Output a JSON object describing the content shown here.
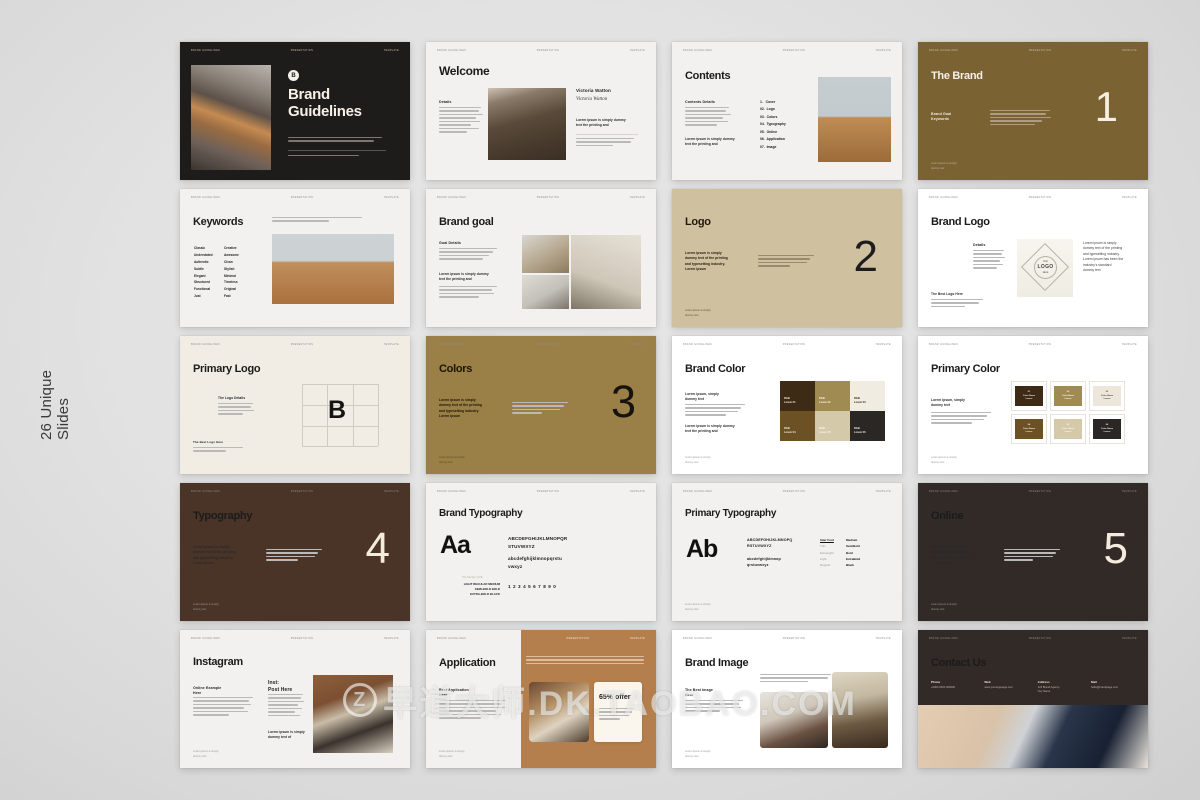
{
  "page": {
    "side_label": "26 Unique\nSlides",
    "background_color": "#e2e2e2"
  },
  "watermark": {
    "mark_letter": "Z",
    "text": "早道大师.DK.TAOBAO.COM"
  },
  "slide_chrome": {
    "header_left": "BRAND  GUIDELINES",
    "header_center": "PRESENTATION",
    "header_right": "TEMPLATE",
    "footer": "Lorem ipsum is simply\ndummy text"
  },
  "palette": {
    "dark": "#1d1c1b",
    "dark_warm": "#312a26",
    "brown": "#7a6233",
    "brown_light": "#9a7f46",
    "brown_deep": "#4a3327",
    "tan": "#cfc0a0",
    "cream": "#f1ede4",
    "offwhite": "#f2f1ef",
    "swatch_1": "#3d2b16",
    "swatch_2": "#a08b52",
    "swatch_3": "#f0ece1",
    "swatch_4": "#6b5124",
    "swatch_5": "#d4c9a8",
    "swatch_6": "#2b2724"
  },
  "slides": [
    {
      "id": "cover",
      "title": "Brand\nGuidelines",
      "logo_mark": "B",
      "body": "Lorem ipsum is simply dummy text of the printing and\ntypesetting industry. Lorem ipsum has been the industry's standard dummy t...",
      "footer": "Lorem ipsum simply dummy text of the printing"
    },
    {
      "id": "welcome",
      "title": "Welcome",
      "label": "Details",
      "person_name": "Victoria Watton",
      "signature": "Victoria Watton",
      "quote": "Lorem ipsum is simply dummy\ntext  the printing and"
    },
    {
      "id": "contents",
      "title": "Contents",
      "label": "Contents Details",
      "items": [
        "1.   Cover",
        "02.  Logo",
        "03.  Colors",
        "04.  Typography",
        "05.  Online",
        "06.  Application",
        "07.  Image"
      ],
      "note": "Lorem ipsum is simply dummy\ntext  the printing and"
    },
    {
      "id": "the-brand",
      "title": "The Brand",
      "label": "Brand Goal\nKeywords",
      "number": "1"
    },
    {
      "id": "keywords",
      "title": "Keywords",
      "intro": "Lorem ipsum is simply dummy text of the printing and typesetting industry. Lorem\nipsum has been the industry's standard dummy",
      "keywords_left": [
        "Classic",
        "Understated",
        "Authentic",
        "Subtle",
        "Elegant",
        "Structured",
        "Functional",
        "Just"
      ],
      "keywords_right": [
        "Creative",
        "Awesome",
        "Clean",
        "Stylish",
        "Minimal",
        "Timeless",
        "Original",
        "Fast"
      ]
    },
    {
      "id": "brand-goal",
      "title": "Brand goal",
      "label": "Goal Details",
      "subhead": "Lorem ipsum is simply dummy\ntext  the printing and"
    },
    {
      "id": "logo",
      "title": "Logo",
      "body": "Lorem ipsum is simply\ndummy text of the printing\nand typesetting industry.\nLorem ipsum",
      "number": "2"
    },
    {
      "id": "brand-logo",
      "title": "Brand   Logo",
      "label": "Details",
      "logo_top": "Your",
      "logo_main": "LOGO",
      "logo_bottom": "Here",
      "body": "Lorem ipsum is simply\ndummy text of the printing\nand typesetting industry.\nLorem ipsum has been the\nindustry's standard\ndummy text",
      "bullets_label": "The Best  Logo Here"
    },
    {
      "id": "primary-logo",
      "title": "Primary Logo",
      "label": "The Logo Details",
      "mark": "B",
      "bullets_label": "The Best Logo Here"
    },
    {
      "id": "colors",
      "title": "Colors",
      "body": "Lorem ipsum is simply\ndummy text of the printing\nand typesetting industry.\nLorem ipsum",
      "number": "3"
    },
    {
      "id": "brand-color",
      "title": "Brand Color",
      "label": "Lorem ipsum, simply\ndummy text",
      "subhead": "Lorem ipsum is simply dummy\ntext  the printing and",
      "swatches": [
        {
          "hex": "#3d2b16",
          "code": "RGB",
          "name": "Lorem 01"
        },
        {
          "hex": "#a08b52",
          "code": "RGB",
          "name": "Lorem 02"
        },
        {
          "hex": "#f0ece1",
          "code": "RGB",
          "name": "Lorem 03"
        },
        {
          "hex": "#6b5124",
          "code": "RGB",
          "name": "Lorem 04"
        },
        {
          "hex": "#d4c9a8",
          "code": "RGB",
          "name": "Lorem 05"
        },
        {
          "hex": "#2b2724",
          "code": "RGB",
          "name": "Lorem 06"
        }
      ]
    },
    {
      "id": "primary-color",
      "title": "Primary Color",
      "label": "Lorem ipsum, simply\ndummy text",
      "cards": [
        {
          "hex": "#3d2b16",
          "num": "01",
          "name": "Color Name\nLorem"
        },
        {
          "hex": "#a08b52",
          "num": "02",
          "name": "Color Name\nLorem"
        },
        {
          "hex": "#ece7da",
          "num": "03",
          "name": "Color Name\nLorem"
        },
        {
          "hex": "#6b5124",
          "num": "04",
          "name": "Color Name\nLorem"
        },
        {
          "hex": "#d4c9a8",
          "num": "05",
          "name": "Color Name\nLorem"
        },
        {
          "hex": "#2b2724",
          "num": "06",
          "name": "Color Name\nLorem"
        }
      ]
    },
    {
      "id": "typography",
      "title": "Typography",
      "body": "Lorem ipsum is simply\ndummy text of the printing\nand typesetting industry.\nLorem ipsum",
      "number": "4"
    },
    {
      "id": "brand-typography",
      "title": "Brand Typography",
      "specimen": "Aa",
      "alphabet_upper": "ABCDEFGHIJKLMNOPQR\nSTUVWXYZ",
      "alphabet_lower": "abcdefghijklmnopqrstu\nvwxyz",
      "numerals": "1 2 3 4 5 6 7 8 9 0",
      "font_label": "The Family LOVE",
      "weights": "LIGHT  REGULAR  MEDIUM\nSEMI-BOLD  BOLD\nEXTRA-BOLD  BLACK"
    },
    {
      "id": "primary-typography",
      "title": "Primary Typography",
      "specimen": "Ab",
      "alphabet_upper": "ABCDEFGHIJKLMNOPQ\nRSTUVWXYZ",
      "alphabet_lower": "abcdefghijklmnop\nqrstuvwxyz",
      "weights_left": [
        "Inter Font",
        "Thin",
        "ExtraLight",
        "Light",
        "Regular"
      ],
      "weights_right": [
        "Medium",
        "SemiBold",
        "Bold",
        "ExtraBold",
        "Black"
      ]
    },
    {
      "id": "online",
      "title": "Online",
      "body": "Lorem ipsum is simply\ndummy text of the printing\nand typesetting industry.\nLorem ipsum",
      "number": "5"
    },
    {
      "id": "instagram",
      "title": "Instagram",
      "label": "Online Example\nHere",
      "post_label": "Inst:\nPost Here",
      "post_footer": "Lorem ipsum is simply\ndummy text of"
    },
    {
      "id": "application",
      "title": "Application",
      "label": "Best Application\nHere",
      "offer": "65% offer"
    },
    {
      "id": "brand-image",
      "title": "Brand Image",
      "label": "The Best  Image\nHere",
      "intro": "Lorem ipsum is simply dummy text of the printing\nand typesetting industry. Lorem ipsum has been the\nindustry's standard"
    },
    {
      "id": "contact-us",
      "title": "Contact Us",
      "fields": [
        {
          "label": "Phone",
          "value": "+0000 0000 000000"
        },
        {
          "label": "Web",
          "value": "www.yourlogopage.com"
        },
        {
          "label": "Address",
          "value": "123 Brand Agency\nCity Name"
        },
        {
          "label": "Mail",
          "value": "hello@brandpage.com"
        }
      ]
    }
  ]
}
